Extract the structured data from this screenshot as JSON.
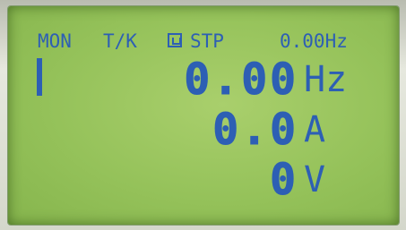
{
  "status": {
    "mode": "MON",
    "control": "T/K",
    "lock_icon": "lock-icon",
    "state": "STP",
    "frequency": "0.00Hz"
  },
  "readouts": [
    {
      "value": "0.00",
      "unit": "Hz"
    },
    {
      "value": "0.0",
      "unit": "A"
    },
    {
      "value": "0",
      "unit": "V"
    }
  ],
  "colors": {
    "segment": "#2d5fb4",
    "backlight": "#95c25a"
  }
}
